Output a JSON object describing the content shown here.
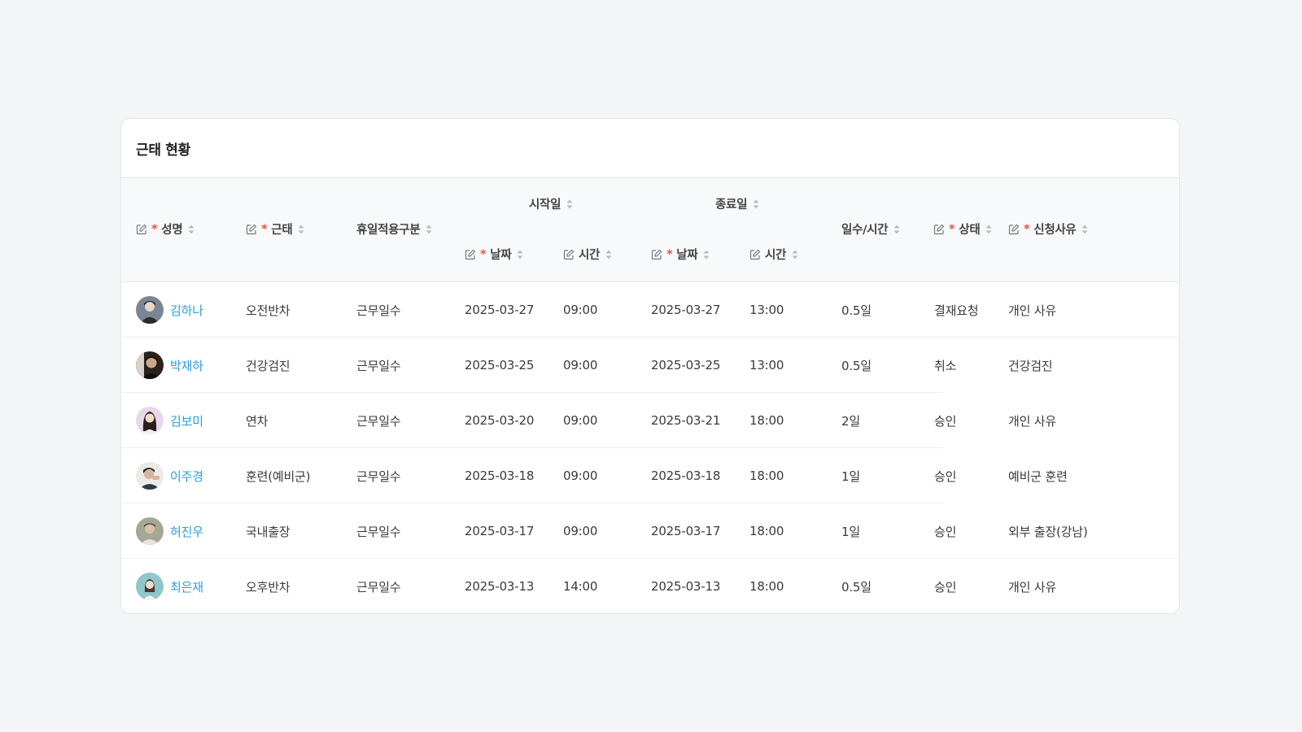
{
  "card": {
    "title": "근태 현황"
  },
  "headers": {
    "name": "성명",
    "attendance": "근태",
    "holiday_type": "휴일적용구분",
    "start_group": "시작일",
    "end_group": "종료일",
    "start_date": "날짜",
    "start_time": "시간",
    "end_date": "날짜",
    "end_time": "시간",
    "duration": "일수/시간",
    "status": "상태",
    "reason": "신청사유"
  },
  "rows": [
    {
      "name": "김하나",
      "attendance": "오전반차",
      "holiday_type": "근무일수",
      "start_date": "2025-03-27",
      "start_time": "09:00",
      "end_date": "2025-03-27",
      "end_time": "13:00",
      "duration": "0.5일",
      "status": "결재요청",
      "reason": "개인 사유",
      "avatar_color": "#6b7b8c"
    },
    {
      "name": "박재하",
      "attendance": "건강검진",
      "holiday_type": "근무일수",
      "start_date": "2025-03-25",
      "start_time": "09:00",
      "end_date": "2025-03-25",
      "end_time": "13:00",
      "duration": "0.5일",
      "status": "취소",
      "reason": "건강검진",
      "avatar_color": "#3a2f28"
    },
    {
      "name": "김보미",
      "attendance": "연차",
      "holiday_type": "근무일수",
      "start_date": "2025-03-20",
      "start_time": "09:00",
      "end_date": "2025-03-21",
      "end_time": "18:00",
      "duration": "2일",
      "status": "승인",
      "reason": "개인 사유",
      "avatar_color": "#d9c6e0"
    },
    {
      "name": "이주경",
      "attendance": "훈련(예비군)",
      "holiday_type": "근무일수",
      "start_date": "2025-03-18",
      "start_time": "09:00",
      "end_date": "2025-03-18",
      "end_time": "18:00",
      "duration": "1일",
      "status": "승인",
      "reason": "예비군 훈련",
      "avatar_color": "#e8e6e2"
    },
    {
      "name": "허진우",
      "attendance": "국내출장",
      "holiday_type": "근무일수",
      "start_date": "2025-03-17",
      "start_time": "09:00",
      "end_date": "2025-03-17",
      "end_time": "18:00",
      "duration": "1일",
      "status": "승인",
      "reason": "외부 출장(강남)",
      "avatar_color": "#9aa08c"
    },
    {
      "name": "최은재",
      "attendance": "오후반차",
      "holiday_type": "근무일수",
      "start_date": "2025-03-13",
      "start_time": "14:00",
      "end_date": "2025-03-13",
      "end_time": "18:00",
      "duration": "0.5일",
      "status": "승인",
      "reason": "개인 사유",
      "avatar_color": "#8cc5c9"
    }
  ],
  "colors": {
    "link": "#2d9cdb",
    "required": "#ef4b4b",
    "header_bg": "#f8f9fa"
  },
  "icons": {
    "edit": "edit-icon",
    "sort": "sort-icon",
    "required": "required-asterisk"
  }
}
